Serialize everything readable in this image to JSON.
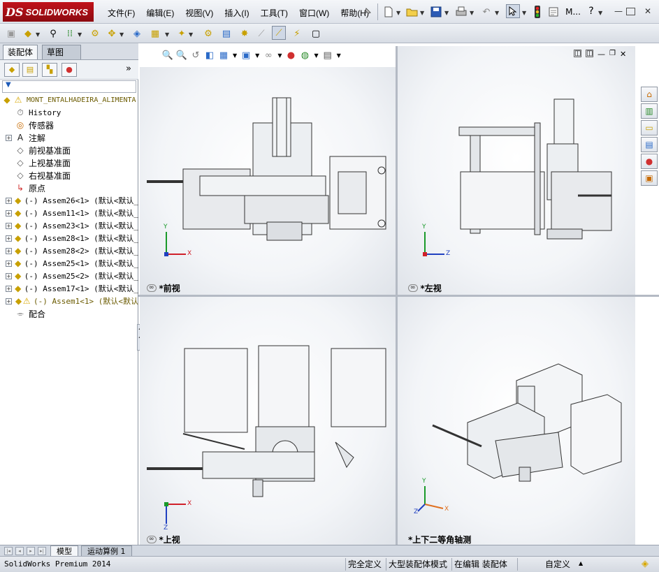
{
  "app": {
    "logo_ds": "DS",
    "logo_name": "SOLIDWORKS"
  },
  "menu": {
    "items": [
      "文件(F)",
      "编辑(E)",
      "视图(V)",
      "插入(I)",
      "工具(T)",
      "窗口(W)",
      "帮助(H)"
    ],
    "short_label": "M..."
  },
  "left_panel": {
    "tabs": [
      "装配体",
      "草图"
    ],
    "root_label": "MONT_ENTALHADEIRA_ALIMENTA",
    "tree_items": [
      {
        "label": "History",
        "icon": "history-icon"
      },
      {
        "label": "传感器",
        "icon": "sensor-icon"
      },
      {
        "label": "注解",
        "icon": "annotation-icon"
      },
      {
        "label": "前视基准面",
        "icon": "plane-icon"
      },
      {
        "label": "上视基准面",
        "icon": "plane-icon"
      },
      {
        "label": "右视基准面",
        "icon": "plane-icon"
      },
      {
        "label": "原点",
        "icon": "origin-icon"
      },
      {
        "label": "(-) Assem26<1> (默认<默认_",
        "icon": "assembly-icon"
      },
      {
        "label": "(-) Assem11<1> (默认<默认_",
        "icon": "assembly-icon"
      },
      {
        "label": "(-) Assem23<1> (默认<默认_",
        "icon": "assembly-icon"
      },
      {
        "label": "(-) Assem28<1> (默认<默认_",
        "icon": "assembly-icon"
      },
      {
        "label": "(-) Assem28<2> (默认<默认_",
        "icon": "assembly-icon"
      },
      {
        "label": "(-) Assem25<1> (默认<默认_",
        "icon": "assembly-icon"
      },
      {
        "label": "(-) Assem25<2> (默认<默认_",
        "icon": "assembly-icon"
      },
      {
        "label": "(-) Assem17<1> (默认<默认_",
        "icon": "assembly-icon"
      },
      {
        "label": "(-) Assem1<1> (默认<默认",
        "icon": "assembly-warning-icon"
      },
      {
        "label": "配合",
        "icon": "mates-icon"
      }
    ]
  },
  "viewports": {
    "front": "*前视",
    "left": "*左视",
    "top": "*上视",
    "iso": "*上下二等角轴测"
  },
  "axes": {
    "x": "X",
    "y": "Y",
    "z": "Z"
  },
  "bottom_tabs": [
    "模型",
    "运动算例 1"
  ],
  "status": {
    "product": "SolidWorks Premium 2014",
    "cells": [
      "完全定义",
      "大型装配体模式",
      "在编辑 装配体",
      "自定义"
    ]
  },
  "colors": {
    "logo_red": "#c1121a",
    "axis_x": "#d0202a",
    "axis_y": "#1a9a2a",
    "axis_z": "#2040c0",
    "axis_iso": "#e07020"
  }
}
